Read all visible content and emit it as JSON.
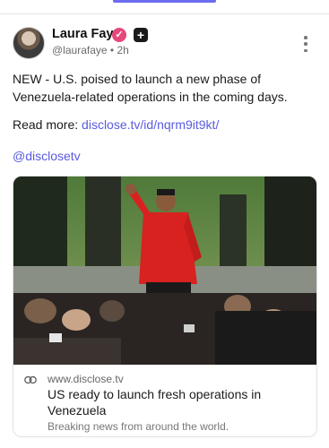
{
  "post": {
    "author_name": "Laura Faye",
    "verified_mark": "✓",
    "plus_badge": "+",
    "handle": "@laurafaye",
    "separator": "•",
    "time": "2h",
    "text_line1": "NEW - U.S. poised to launch a new phase of Venezuela-related operations in the coming days.",
    "read_more_label": "Read more: ",
    "read_more_link": "disclose.tv/id/nqrm9it9kt/",
    "mention": "@disclosetv"
  },
  "link_card": {
    "domain": "www.disclose.tv",
    "title": "US ready to launch fresh operations in Venezuela",
    "description": "Breaking news from around the world."
  },
  "colors": {
    "accent": "#5a5ae0",
    "verified": "#e5487a",
    "tab_indicator": "#6c6cf0"
  },
  "icons": [
    "verified-badge-icon",
    "plus-badge-icon",
    "more-options-icon",
    "link-icon"
  ]
}
